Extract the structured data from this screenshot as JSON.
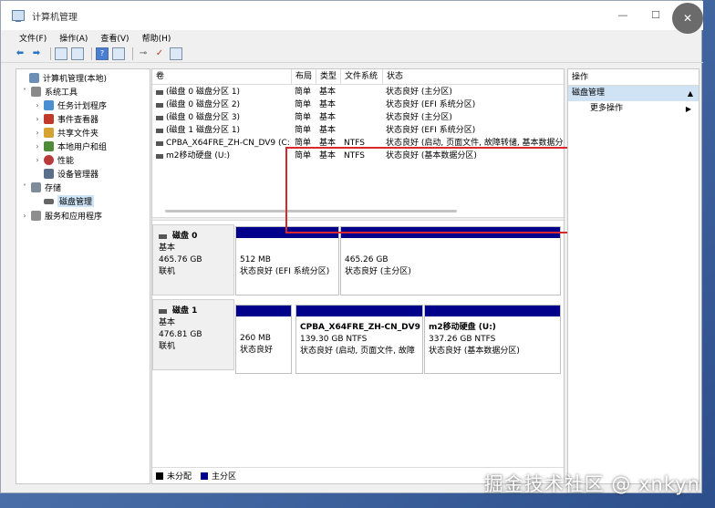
{
  "window": {
    "title": "计算机管理"
  },
  "controls": {
    "minimize": "—",
    "maximize": "☐",
    "close": "✕"
  },
  "menu": [
    "文件(F)",
    "操作(A)",
    "查看(V)",
    "帮助(H)"
  ],
  "tree": [
    {
      "label": "计算机管理(本地)",
      "expander": "",
      "level": 0,
      "icon_color": "#6e8fb5"
    },
    {
      "label": "系统工具",
      "expander": "˅",
      "level": 1,
      "icon_color": "#8a8a8a"
    },
    {
      "label": "任务计划程序",
      "expander": "›",
      "level": 2,
      "icon_color": "#4b8ed1"
    },
    {
      "label": "事件查看器",
      "expander": "›",
      "level": 2,
      "icon_color": "#c0392b"
    },
    {
      "label": "共享文件夹",
      "expander": "›",
      "level": 2,
      "icon_color": "#d6a232"
    },
    {
      "label": "本地用户和组",
      "expander": "›",
      "level": 2,
      "icon_color": "#4f8b3a"
    },
    {
      "label": "性能",
      "expander": "›",
      "level": 2,
      "icon_color": "#b83a3a"
    },
    {
      "label": "设备管理器",
      "expander": "",
      "level": 2,
      "icon_color": "#5b6f8a"
    },
    {
      "label": "存储",
      "expander": "˅",
      "level": 1,
      "icon_color": "#7f8c99"
    },
    {
      "label": "磁盘管理",
      "expander": "",
      "level": 2,
      "icon_color": "#666666",
      "selected": true
    },
    {
      "label": "服务和应用程序",
      "expander": "›",
      "level": 1,
      "icon_color": "#8e8e8e"
    }
  ],
  "volume_table": {
    "headers": [
      "卷",
      "布局",
      "类型",
      "文件系统",
      "状态"
    ],
    "rows": [
      [
        "(磁盘 0 磁盘分区 1)",
        "简单",
        "基本",
        "",
        "状态良好 (主分区)"
      ],
      [
        "(磁盘 0 磁盘分区 2)",
        "简单",
        "基本",
        "",
        "状态良好 (EFI 系统分区)"
      ],
      [
        "(磁盘 0 磁盘分区 3)",
        "简单",
        "基本",
        "",
        "状态良好 (主分区)"
      ],
      [
        "(磁盘 1 磁盘分区 1)",
        "简单",
        "基本",
        "",
        "状态良好 (EFI 系统分区)"
      ],
      [
        "CPBA_X64FRE_ZH-CN_DV9 (C:)",
        "简单",
        "基本",
        "NTFS",
        "状态良好 (启动, 页面文件, 故障转储, 基本数据分"
      ],
      [
        "m2移动硬盘 (U:)",
        "简单",
        "基本",
        "NTFS",
        "状态良好 (基本数据分区)"
      ]
    ]
  },
  "disks": [
    {
      "name": "磁盘 0",
      "type": "基本",
      "size": "465.76 GB",
      "status": "联机",
      "partitions": [
        {
          "name": "",
          "size": "512 MB",
          "status": "状态良好 (EFI 系统分区)"
        },
        {
          "name": "",
          "size": "465.26 GB",
          "status": "状态良好 (主分区)"
        }
      ]
    },
    {
      "name": "磁盘 1",
      "type": "基本",
      "size": "476.81 GB",
      "status": "联机",
      "partitions": [
        {
          "name": "",
          "size": "260 MB",
          "status": "状态良好"
        },
        {
          "name": "CPBA_X64FRE_ZH-CN_DV9",
          "size": "139.30 GB NTFS",
          "status": "状态良好 (启动, 页面文件, 故障"
        },
        {
          "name": "m2移动硬盘 (U:)",
          "size": "337.26 GB NTFS",
          "status": "状态良好 (基本数据分区)"
        }
      ]
    }
  ],
  "legend": [
    {
      "label": "未分配",
      "color": "#000000"
    },
    {
      "label": "主分区",
      "color": "#00008b"
    }
  ],
  "actions": {
    "header": "操作",
    "section": "磁盘管理",
    "more": "更多操作"
  },
  "watermark": "掘金技术社区 @ xnkyn"
}
